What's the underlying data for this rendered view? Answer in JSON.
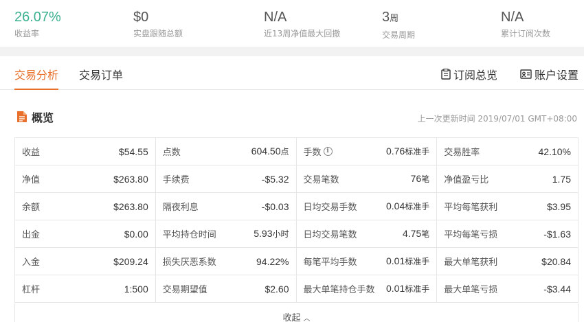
{
  "stats": [
    {
      "value": "26.07%",
      "unit": "",
      "label": "收益率",
      "color": "#3bb08f"
    },
    {
      "value": "$0",
      "unit": "",
      "label": "实盘跟随总额"
    },
    {
      "value": "N/A",
      "unit": "",
      "label": "近13周净值最大回撤"
    },
    {
      "value": "3",
      "unit": "周",
      "label": "交易周期"
    },
    {
      "value": "N/A",
      "unit": "",
      "label": "累计订阅次数"
    }
  ],
  "tabs": {
    "analysis": "交易分析",
    "orders": "交易订单",
    "subscription_overview": "订阅总览",
    "account_settings": "账户设置"
  },
  "overview": {
    "title": "概览",
    "updated": "上一次更新时间 2019/07/01 GMT+08:00",
    "collapse_label": "收起",
    "rows": [
      [
        {
          "k": "收益",
          "v": "$54.55",
          "u": ""
        },
        {
          "k": "点数",
          "v": "604.50",
          "u": "点"
        },
        {
          "k": "手数",
          "v": "0.76",
          "u": "标准手",
          "info": true
        },
        {
          "k": "交易胜率",
          "v": "42.10%",
          "u": ""
        }
      ],
      [
        {
          "k": "净值",
          "v": "$263.80",
          "u": ""
        },
        {
          "k": "手续费",
          "v": "-$5.32",
          "u": ""
        },
        {
          "k": "交易笔数",
          "v": "76",
          "u": "笔"
        },
        {
          "k": "净值盈亏比",
          "v": "1.75",
          "u": ""
        }
      ],
      [
        {
          "k": "余额",
          "v": "$263.80",
          "u": ""
        },
        {
          "k": "隔夜利息",
          "v": "-$0.03",
          "u": ""
        },
        {
          "k": "日均交易手数",
          "v": "0.04",
          "u": "标准手"
        },
        {
          "k": "平均每笔获利",
          "v": "$3.95",
          "u": ""
        }
      ],
      [
        {
          "k": "出金",
          "v": "$0.00",
          "u": ""
        },
        {
          "k": "平均持仓时间",
          "v": "5.93",
          "u": "小时"
        },
        {
          "k": "日均交易笔数",
          "v": "4.75",
          "u": "笔"
        },
        {
          "k": "平均每笔亏损",
          "v": "-$1.63",
          "u": ""
        }
      ],
      [
        {
          "k": "入金",
          "v": "$209.24",
          "u": ""
        },
        {
          "k": "损失厌恶系数",
          "v": "94.22%",
          "u": ""
        },
        {
          "k": "每笔平均手数",
          "v": "0.01",
          "u": "标准手"
        },
        {
          "k": "最大单笔获利",
          "v": "$20.84",
          "u": ""
        }
      ],
      [
        {
          "k": "杠杆",
          "v": "1:500",
          "u": ""
        },
        {
          "k": "交易期望值",
          "v": "$2.60",
          "u": ""
        },
        {
          "k": "最大单笔持仓手数",
          "v": "0.01",
          "u": "标准手"
        },
        {
          "k": "最大单笔亏损",
          "v": "-$3.44",
          "u": ""
        }
      ]
    ]
  },
  "colors": {
    "accent": "#e8702a",
    "positive": "#3bb08f"
  }
}
